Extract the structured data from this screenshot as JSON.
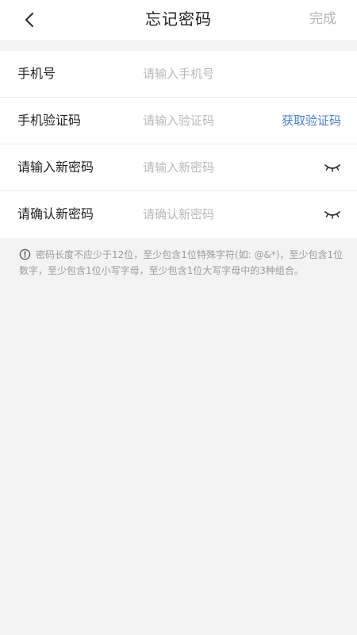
{
  "header": {
    "title": "忘记密码",
    "done_label": "完成",
    "back_icon": "chevron-left-icon"
  },
  "form": {
    "rows": [
      {
        "label": "手机号",
        "placeholder": "请输入手机号",
        "value": ""
      },
      {
        "label": "手机验证码",
        "placeholder": "请输入验证码",
        "value": "",
        "action_label": "获取验证码"
      },
      {
        "label": "请输入新密码",
        "placeholder": "请输入新密码",
        "value": "",
        "icon": "eye-closed-icon"
      },
      {
        "label": "请确认新密码",
        "placeholder": "请确认新密码",
        "value": "",
        "icon": "eye-closed-icon"
      }
    ]
  },
  "hint": {
    "icon": "info-icon",
    "text": "密码长度不应少于12位，至少包含1位特殊字符(如: @&*)，至少包含1位数字，至少包含1位小写字母，至少包含1位大写字母中的3种组合。"
  },
  "colors": {
    "accent": "#4a7fd6",
    "background": "#f3f3f3",
    "muted": "#b9b9b9"
  }
}
